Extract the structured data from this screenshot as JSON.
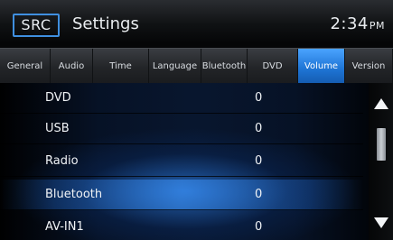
{
  "header": {
    "src_label": "SRC",
    "title": "Settings",
    "clock_time": "2:34",
    "clock_ampm": "PM"
  },
  "tabs": [
    {
      "label": "General",
      "active": false
    },
    {
      "label": "Audio",
      "active": false
    },
    {
      "label": "Time",
      "active": false
    },
    {
      "label": "Language",
      "active": false
    },
    {
      "label": "Bluetooth",
      "active": false
    },
    {
      "label": "DVD",
      "active": false
    },
    {
      "label": "Volume",
      "active": true
    },
    {
      "label": "Version",
      "active": false
    }
  ],
  "list": {
    "rows": [
      {
        "label": "DVD",
        "value": "0",
        "selected": false
      },
      {
        "label": "USB",
        "value": "0",
        "selected": false
      },
      {
        "label": "Radio",
        "value": "0",
        "selected": false
      },
      {
        "label": "Bluetooth",
        "value": "0",
        "selected": true
      },
      {
        "label": "AV-IN1",
        "value": "0",
        "selected": false
      }
    ]
  },
  "scrollbar": {
    "up_icon": "triangle-up-icon",
    "down_icon": "triangle-down-icon"
  },
  "colors": {
    "accent": "#2b86e6",
    "src_border": "#3f8fe0",
    "background": "#050607"
  }
}
